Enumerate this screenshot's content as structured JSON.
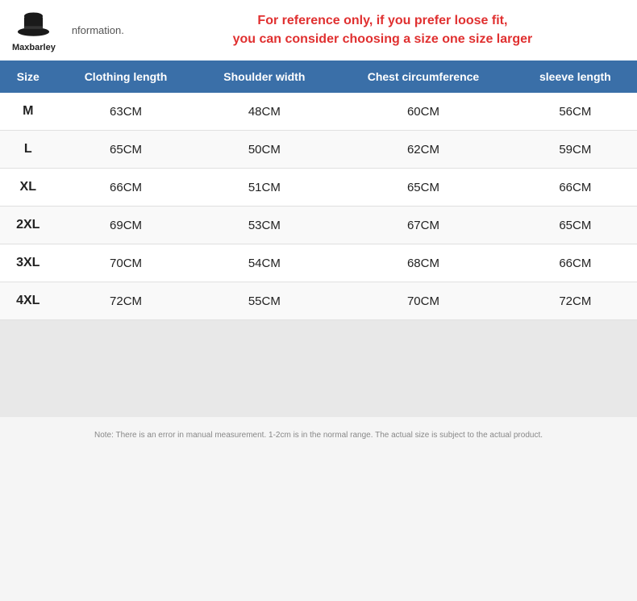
{
  "brand": {
    "name": "Maxbarley"
  },
  "top_info": "nformation.",
  "reference_text_line1": "For reference only, if you prefer loose fit,",
  "reference_text_line2": "you can consider choosing a size one size larger",
  "table": {
    "headers": [
      "Size",
      "Clothing length",
      "Shoulder width",
      "Chest circumference",
      "sleeve length"
    ],
    "rows": [
      {
        "size": "M",
        "clothing_length": "63CM",
        "shoulder_width": "48CM",
        "chest": "60CM",
        "sleeve": "56CM"
      },
      {
        "size": "L",
        "clothing_length": "65CM",
        "shoulder_width": "50CM",
        "chest": "62CM",
        "sleeve": "59CM"
      },
      {
        "size": "XL",
        "clothing_length": "66CM",
        "shoulder_width": "51CM",
        "chest": "65CM",
        "sleeve": "66CM"
      },
      {
        "size": "2XL",
        "clothing_length": "69CM",
        "shoulder_width": "53CM",
        "chest": "67CM",
        "sleeve": "65CM"
      },
      {
        "size": "3XL",
        "clothing_length": "70CM",
        "shoulder_width": "54CM",
        "chest": "68CM",
        "sleeve": "66CM"
      },
      {
        "size": "4XL",
        "clothing_length": "72CM",
        "shoulder_width": "55CM",
        "chest": "70CM",
        "sleeve": "72CM"
      }
    ]
  },
  "note": "Note: There is an error in manual measurement. 1-2cm is in the normal range. The actual size is subject to the actual product."
}
